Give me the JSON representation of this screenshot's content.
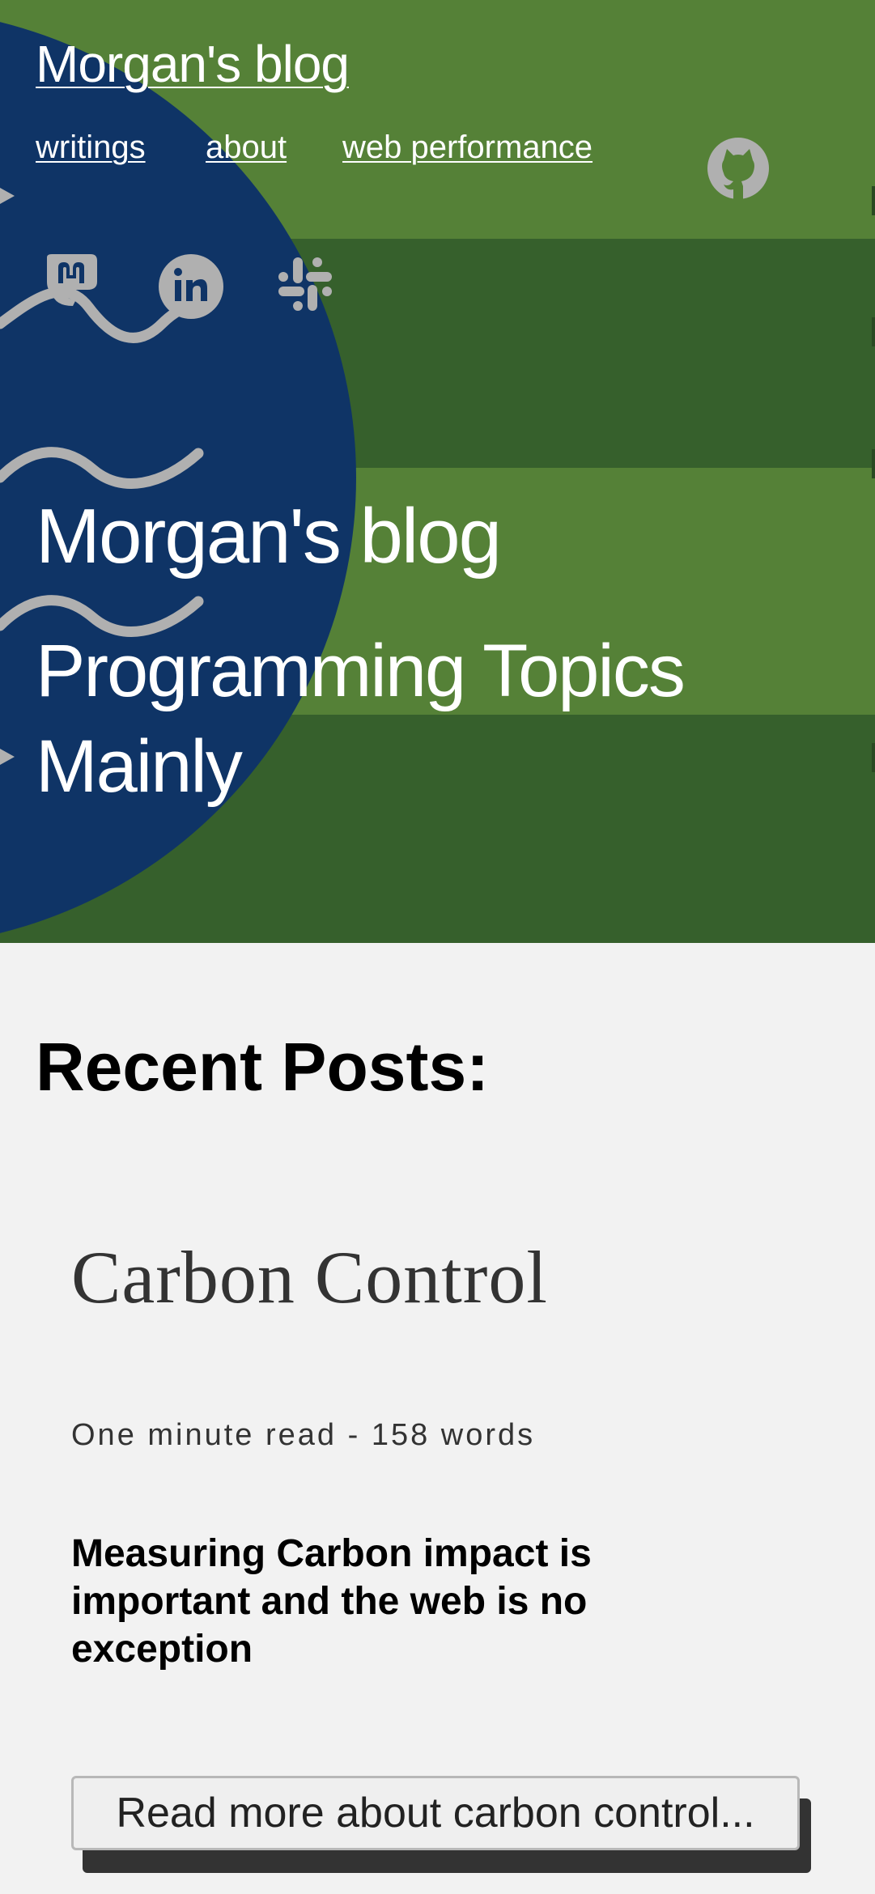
{
  "header": {
    "site_title": "Morgan's blog",
    "nav": [
      {
        "label": "writings"
      },
      {
        "label": "about"
      },
      {
        "label": "web performance"
      }
    ],
    "social_icons": [
      "github-icon",
      "mastodon-icon",
      "linkedin-icon",
      "slack-icon"
    ]
  },
  "hero": {
    "title": "Morgan's blog",
    "subtitle": "Programming Topics Mainly"
  },
  "main": {
    "section_heading": "Recent Posts:",
    "posts": [
      {
        "title": "Carbon Control",
        "meta": "One minute read - 158 words",
        "excerpt": "Measuring Carbon impact is important and the web is no exception",
        "cta": "Read more about carbon control..."
      }
    ]
  },
  "colors": {
    "green_light": "#558137",
    "green_dark": "#36602c",
    "navy": "#0f3466",
    "icon_gray": "#b0b0b0",
    "background": "#f2f2f2"
  }
}
